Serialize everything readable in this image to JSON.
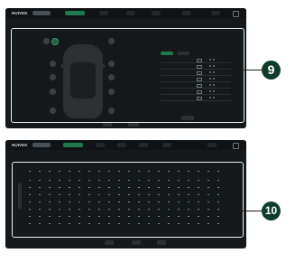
{
  "screen1": {
    "logo": "HUIVEK",
    "tabs": [
      {
        "label": "",
        "style": "grey"
      },
      {
        "label": "",
        "style": "green"
      }
    ],
    "seats": [
      {
        "name": "seat-front-left",
        "active": false
      },
      {
        "name": "seat-front-left-heat",
        "active": true
      },
      {
        "name": "seat-front-right",
        "active": false
      },
      {
        "name": "seat-rear-left-1",
        "active": false
      },
      {
        "name": "seat-rear-right-1",
        "active": false
      },
      {
        "name": "seat-rear-left-2",
        "active": false
      },
      {
        "name": "seat-rear-right-2",
        "active": false
      },
      {
        "name": "seat-rear-left-3",
        "active": false
      },
      {
        "name": "seat-rear-right-3",
        "active": false
      },
      {
        "name": "seat-rear-left-4",
        "active": false
      },
      {
        "name": "seat-rear-right-4",
        "active": false
      }
    ],
    "panel_rows": [
      "",
      "",
      "",
      "",
      "",
      "",
      ""
    ],
    "callout_number": "9"
  },
  "screen2": {
    "logo": "HUIVEK",
    "callout_number": "10"
  },
  "colors": {
    "screen_bg": "#15191c",
    "accent_green": "#1f7a4d",
    "badge": "#0f3d2a",
    "callout_border": "#e9eef0"
  }
}
